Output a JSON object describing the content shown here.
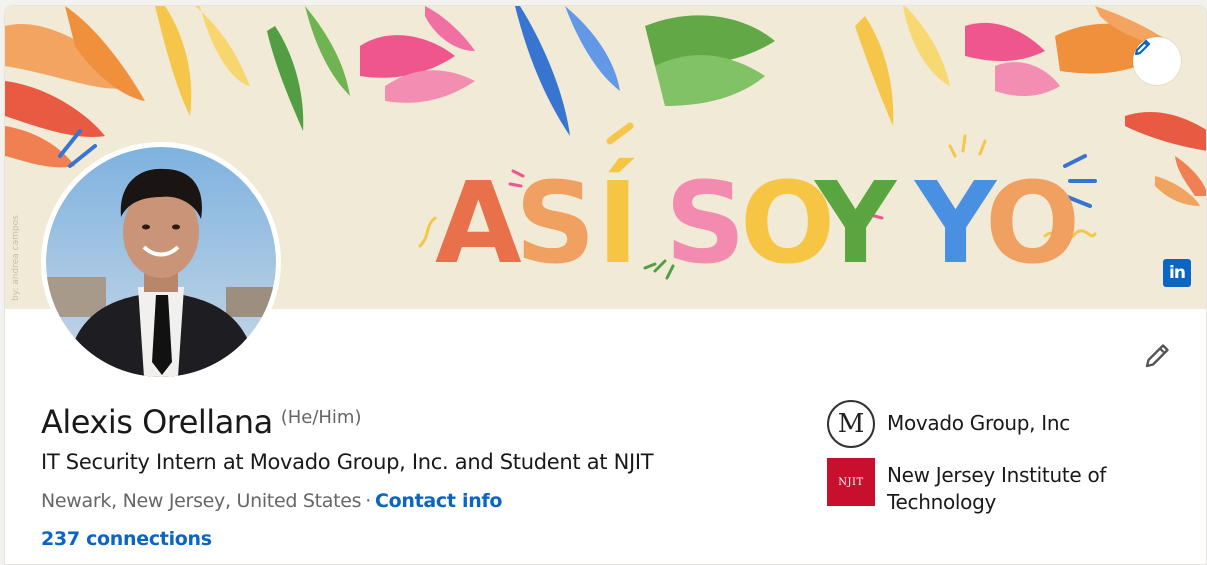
{
  "banner": {
    "slogan": "ASÍ SOY YO",
    "credit": "by: andrea campos",
    "edit_icon": "pencil-icon",
    "brand_logo_text": "in"
  },
  "profile": {
    "name": "Alexis Orellana",
    "pronouns": "(He/Him)",
    "headline": "IT Security Intern at Movado Group, Inc. and Student at NJIT",
    "location": "Newark, New Jersey, United States",
    "separator": "·",
    "contact_info_label": "Contact info",
    "connections": "237 connections",
    "edit_icon": "pencil-icon"
  },
  "organizations": [
    {
      "name": "Movado Group, Inc",
      "logo_text": "M"
    },
    {
      "name": "New Jersey Institute of Technology",
      "logo_text": "NJIT"
    }
  ],
  "colors": {
    "link": "#0a66c2",
    "banner_bg": "#f1ead7",
    "njit_red": "#c8102e"
  }
}
